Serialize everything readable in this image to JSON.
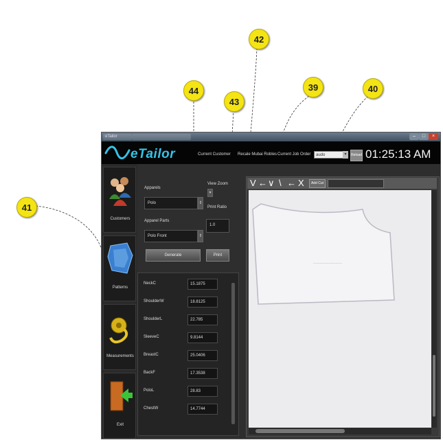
{
  "callouts": [
    "42",
    "44",
    "43",
    "39",
    "40",
    "41"
  ],
  "titlebar": {
    "app_tab": "eTailor",
    "tab2": ""
  },
  "header": {
    "logo": "eTailor",
    "menu": [
      "Current Customer",
      "Recale Mubai Robles",
      "Current Job Order"
    ],
    "job_order_value": "audo",
    "reload_label": "Reload",
    "clock": "01:25:13 AM"
  },
  "nav": [
    {
      "label": "Customers",
      "icon": "customers-icon"
    },
    {
      "label": "Patterns",
      "icon": "patterns-icon"
    },
    {
      "label": "Measurements",
      "icon": "measuring-tape-icon"
    },
    {
      "label": "Exit",
      "icon": "exit-door-icon"
    }
  ],
  "form": {
    "apparels_label": "Apparels",
    "apparel_value": "Polo",
    "apparel_parts_label": "Apparel Parts",
    "apparel_part_value": "Polo Front",
    "view_zoom_label": "View Zoom",
    "print_ratio_label": "Print Ratio",
    "print_ratio_value": "1.0",
    "generate_label": "Generate",
    "print_label": "Print"
  },
  "measurements": [
    {
      "name": "NeckC",
      "value": "15.1875"
    },
    {
      "name": "ShoulderW",
      "value": "18.8125"
    },
    {
      "name": "ShoulderL",
      "value": "22.785"
    },
    {
      "name": "SleeveC",
      "value": "9.8144"
    },
    {
      "name": "BreastC",
      "value": "25.0406"
    },
    {
      "name": "BackF",
      "value": "17.3538"
    },
    {
      "name": "PoloL",
      "value": "28.83"
    },
    {
      "name": "ChestW",
      "value": "14.7744"
    }
  ],
  "toolbar": {
    "tools": [
      "V",
      "←",
      "∨",
      "\\",
      "←",
      "X"
    ],
    "add_cut_label": "Add Cut"
  },
  "canvas": {
    "piece_label": "~~~~~~~~~~~~~~~~~~"
  },
  "colors": {
    "accent": "#34c3e8",
    "callout": "#f4e414",
    "header_bg": "#050505",
    "panel_bg": "#2e2e2e"
  }
}
